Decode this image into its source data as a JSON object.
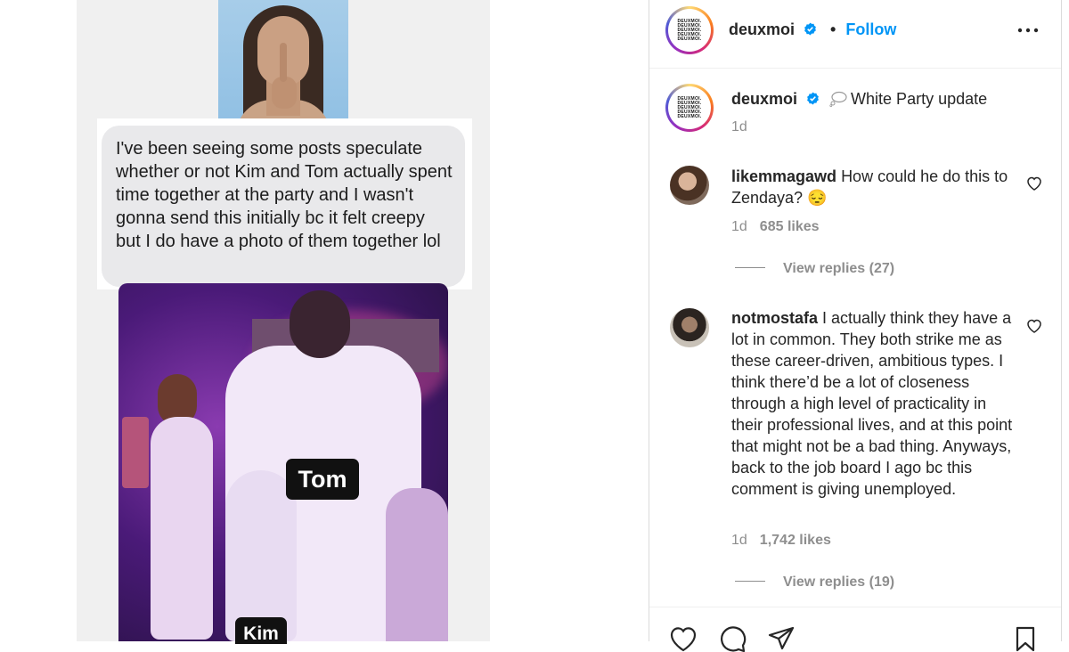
{
  "post": {
    "message_text": "I've been seeing some posts speculate whether or not Kim and Tom actually spent time together at the party and I wasn't gonna send this initially bc it felt creepy but I do have a photo of them together lol",
    "label_tom": "Tom",
    "label_kim": "Kim"
  },
  "header": {
    "username": "deuxmoi",
    "dot": "•",
    "follow_label": "Follow",
    "avatar_text": "DEUXMOI."
  },
  "caption": {
    "username": "deuxmoi",
    "text": "White Party update",
    "time": "1d"
  },
  "comments": [
    {
      "username": "likemmagawd",
      "text": "How could he do this to Zendaya? 😔",
      "time": "1d",
      "likes": "685 likes",
      "view_replies": "View replies (27)"
    },
    {
      "username": "notmostafa",
      "text": "I actually think they have a lot in common. They both strike me as these career-driven, ambitious types. I think there’d be a lot of closeness through a high level of practicality in their professional lives, and at this point that might not be a bad thing. Anyways, back to the job board I ago bc this comment is giving unemployed.",
      "time": "1d",
      "likes": "1,742 likes",
      "view_replies": "View replies (19)"
    }
  ],
  "colors": {
    "accent": "#0095f6",
    "secondary_text": "#8e8e8e",
    "verified": "#0095f6"
  },
  "icons": [
    "more-icon",
    "verified-icon",
    "thought-bubble-icon",
    "heart-icon",
    "comment-icon",
    "share-icon",
    "bookmark-icon"
  ]
}
